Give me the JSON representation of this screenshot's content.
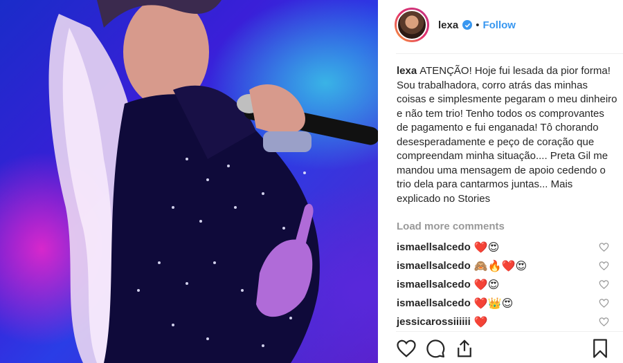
{
  "header": {
    "username": "lexa",
    "separator": "•",
    "follow_label": "Follow"
  },
  "caption": {
    "author": "lexa",
    "text": "ATENÇÃO! Hoje fui lesada da pior forma! Sou trabalhadora, corro atrás das minhas coisas e simplesmente pegaram o meu dinheiro e não tem trio! Tenho todos os comprovantes de pagamento e fui enganada! Tô chorando desesperadamente e peço de coração que compreendam minha situação.... Preta Gil me mandou uma mensagem de apoio cedendo o trio dela para cantarmos juntas... Mais explicado no Stories"
  },
  "load_more_label": "Load more comments",
  "comments": [
    {
      "user": "ismaellsalcedo",
      "text": "❤️😍"
    },
    {
      "user": "ismaellsalcedo",
      "text": "🙈🔥❤️😍"
    },
    {
      "user": "ismaellsalcedo",
      "text": "❤️😍"
    },
    {
      "user": "ismaellsalcedo",
      "text": "❤️👑😍"
    },
    {
      "user": "jessicarossiiiiii",
      "text": "❤️"
    }
  ],
  "icons": {
    "verified": "verified-badge-icon",
    "comment_like": "heart-outline-icon",
    "like": "heart-outline-icon",
    "comment": "comment-bubble-icon",
    "share": "share-icon",
    "save": "bookmark-icon"
  },
  "colors": {
    "link_blue": "#3897f0",
    "muted_gray": "#999999",
    "text": "#262626"
  }
}
